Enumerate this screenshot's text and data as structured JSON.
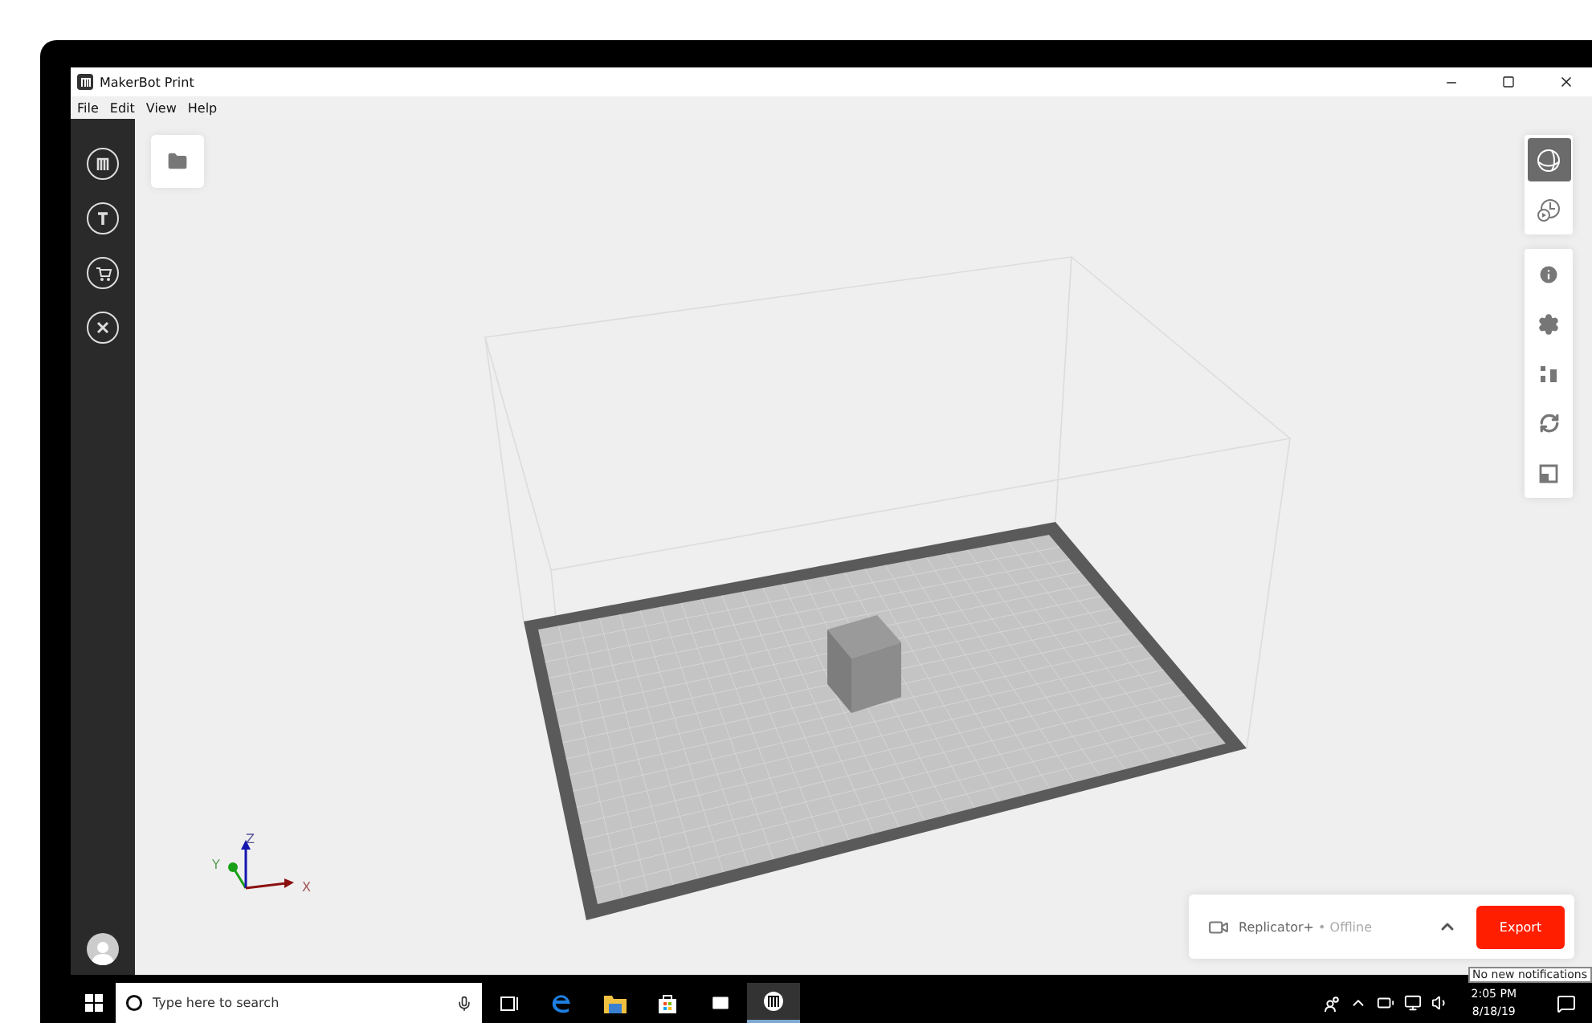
{
  "window": {
    "title": "MakerBot Print"
  },
  "menu": [
    "File",
    "Edit",
    "View",
    "Help"
  ],
  "view_modes": [
    {
      "kind": "model",
      "selected": true
    },
    {
      "kind": "preview",
      "selected": false
    }
  ],
  "axes": [
    "Z",
    "Y",
    "X"
  ],
  "printer": {
    "name": "Replicator+",
    "status": "• Offline",
    "expanded": false
  },
  "export_button": "Export",
  "tooltip": "No new notifications",
  "taskbar": {
    "search_placeholder": "Type here to search",
    "time": "2:05 PM",
    "date": "8/18/19"
  }
}
